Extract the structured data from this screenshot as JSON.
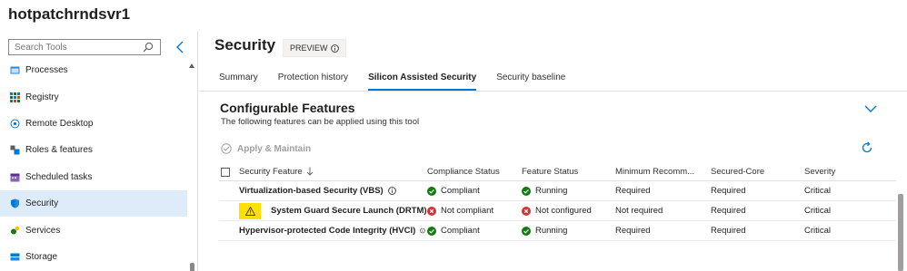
{
  "app": {
    "title": "hotpatchrndsvr1"
  },
  "sidebar": {
    "search_placeholder": "Search Tools",
    "items": [
      {
        "label": "Processes",
        "icon": "processes-icon",
        "active": false
      },
      {
        "label": "Registry",
        "icon": "registry-icon",
        "active": false
      },
      {
        "label": "Remote Desktop",
        "icon": "remote-desktop-icon",
        "active": false
      },
      {
        "label": "Roles & features",
        "icon": "roles-features-icon",
        "active": false
      },
      {
        "label": "Scheduled tasks",
        "icon": "scheduled-tasks-icon",
        "active": false
      },
      {
        "label": "Security",
        "icon": "shield-icon",
        "active": true
      },
      {
        "label": "Services",
        "icon": "services-icon",
        "active": false
      },
      {
        "label": "Storage",
        "icon": "storage-icon",
        "active": false
      }
    ]
  },
  "page": {
    "title": "Security",
    "badge": "PREVIEW",
    "tabs": [
      {
        "label": "Summary",
        "active": false
      },
      {
        "label": "Protection history",
        "active": false
      },
      {
        "label": "Silicon Assisted Security",
        "active": true
      },
      {
        "label": "Security baseline",
        "active": false
      }
    ]
  },
  "section": {
    "title": "Configurable Features",
    "subtitle": "The following features can be applied using this tool",
    "apply_label": "Apply & Maintain"
  },
  "table": {
    "columns": [
      "Security Feature",
      "Compliance Status",
      "Feature Status",
      "Minimum Recomm...",
      "Secured-Core",
      "Severity"
    ],
    "rows": [
      {
        "feature": "Virtualization-based Security (VBS)",
        "compliance": "Compliant",
        "compliance_ok": true,
        "status": "Running",
        "status_ok": true,
        "minimum": "Required",
        "secured_core": "Required",
        "severity": "Critical",
        "warning": false,
        "has_info": true
      },
      {
        "feature": "System Guard Secure Launch (DRTM) ...",
        "compliance": "Not compliant",
        "compliance_ok": false,
        "status": "Not configured",
        "status_ok": false,
        "minimum": "Not required",
        "secured_core": "Required",
        "severity": "Critical",
        "warning": true,
        "has_info": false
      },
      {
        "feature": "Hypervisor-protected Code Integrity (HVCI)",
        "compliance": "Compliant",
        "compliance_ok": true,
        "status": "Running",
        "status_ok": true,
        "minimum": "Required",
        "secured_core": "Required",
        "severity": "Critical",
        "warning": false,
        "has_info": true
      }
    ]
  },
  "colors": {
    "accent": "#0078d4",
    "success": "#107c10",
    "error": "#d13438",
    "warning": "#fce100",
    "active_bg": "#deecf9"
  }
}
